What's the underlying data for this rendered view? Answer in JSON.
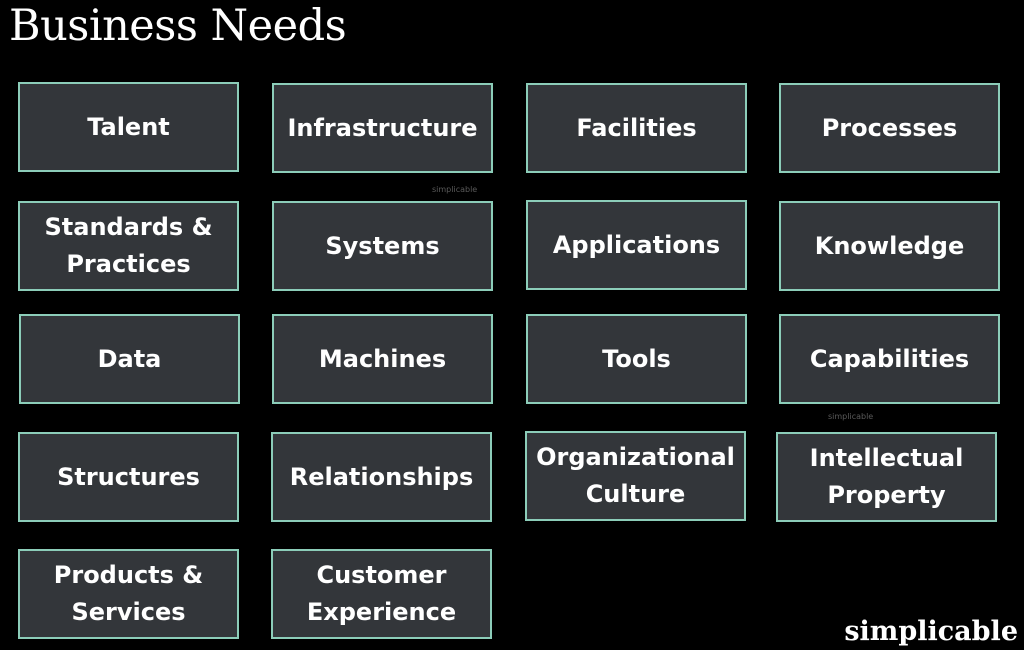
{
  "title": "Business Needs",
  "items": [
    "Talent",
    "Infrastructure",
    "Facilities",
    "Processes",
    "Standards &\nPractices",
    "Systems",
    "Applications",
    "Knowledge",
    "Data",
    "Machines",
    "Tools",
    "Capabilities",
    "Structures",
    "Relationships",
    "Organizational\nCulture",
    "Intellectual\nProperty",
    "Products &\nServices",
    "Customer\nExperience"
  ],
  "watermark": "simplicable",
  "brand": "simplicable",
  "colors": {
    "background": "#000000",
    "box_fill": "#33363a",
    "box_border": "#8ccdb9",
    "text": "#ffffff"
  }
}
